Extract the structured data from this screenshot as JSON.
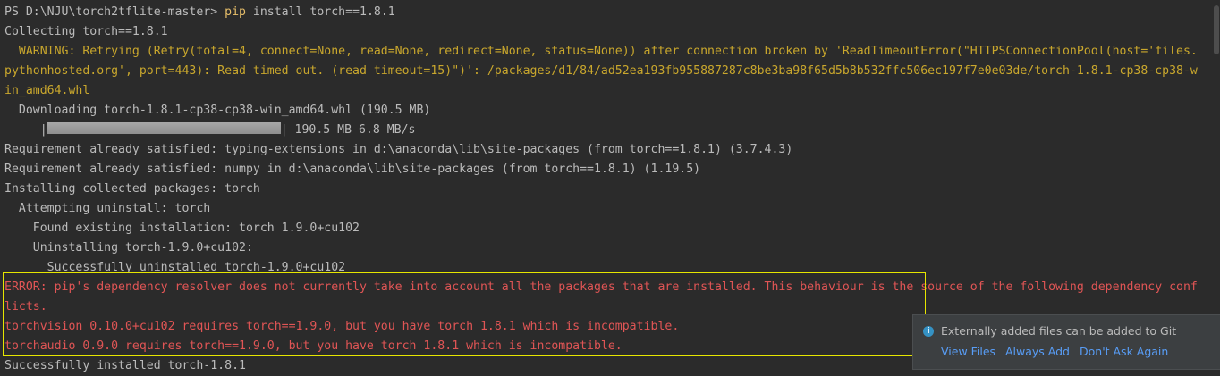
{
  "terminal": {
    "prompt": "PS D:\\NJU\\torch2tflite-master> ",
    "command": "pip",
    "command_args": " install torch==1.8.1",
    "lines": [
      "Collecting torch==1.8.1",
      "  WARNING: Retrying (Retry(total=4, connect=None, read=None, redirect=None, status=None)) after connection broken by 'ReadTimeoutError(\"HTTPSConnectionPool(host='files.",
      "pythonhosted.org', port=443): Read timed out. (read timeout=15)\")': /packages/d1/84/ad52ea193fb955887287c8be3ba98f65d5b8b532ffc506ec197f7e0e03de/torch-1.8.1-cp38-cp38-w",
      "in_amd64.whl",
      "  Downloading torch-1.8.1-cp38-cp38-win_amd64.whl (190.5 MB)",
      "     |",
      "| 190.5 MB 6.8 MB/s",
      "Requirement already satisfied: typing-extensions in d:\\anaconda\\lib\\site-packages (from torch==1.8.1) (3.7.4.3)",
      "Requirement already satisfied: numpy in d:\\anaconda\\lib\\site-packages (from torch==1.8.1) (1.19.5)",
      "Installing collected packages: torch",
      "  Attempting uninstall: torch",
      "    Found existing installation: torch 1.9.0+cu102",
      "    Uninstalling torch-1.9.0+cu102:",
      "      Successfully uninstalled torch-1.9.0+cu102",
      "ERROR: pip's dependency resolver does not currently take into account all the packages that are installed. This behaviour is the source of the following dependency conf",
      "licts.",
      "torchvision 0.10.0+cu102 requires torch==1.9.0, but you have torch 1.8.1 which is incompatible.",
      "torchaudio 0.9.0 requires torch==1.9.0, but you have torch 1.8.1 which is incompatible.",
      "Successfully installed torch-1.8.1"
    ],
    "download_progress": 1.0
  },
  "notification": {
    "icon": "info-icon",
    "title": "Externally added files can be added to Git",
    "actions": [
      "View Files",
      "Always Add",
      "Don't Ask Again"
    ]
  },
  "colors": {
    "background": "#2b2b2b",
    "text": "#bbbbbb",
    "warning": "#c9a72d",
    "error": "#e05555",
    "highlight_border": "#e6e600",
    "link": "#589df6"
  }
}
